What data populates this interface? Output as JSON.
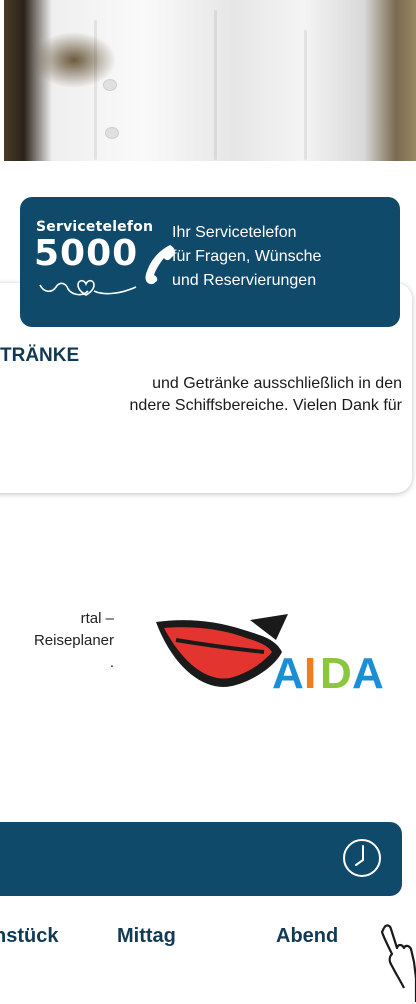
{
  "service": {
    "label": "Servicetelefon",
    "number": "5000",
    "text_line1": "Ihr Servicetelefon",
    "text_line2": "für Fragen, Wünsche",
    "text_line3": "und Reservierungen"
  },
  "notice": {
    "title": "TRÄNKE",
    "body_line1": "und Getränke ausschließlich in den",
    "body_line2": "ndere Schiffsbereiche. Vielen Dank für"
  },
  "portal": {
    "line1": "rtal –",
    "line2": "Reiseplaner",
    "line3": "."
  },
  "logo": {
    "text": "AIDA",
    "colors": [
      "#1a8fd6",
      "#f07c1a",
      "#8cc63f",
      "#1a8fd6"
    ]
  },
  "colors": {
    "brand_navy": "#0f4a6b",
    "lips_red": "#e3342f"
  },
  "meal_tabs": {
    "breakfast": "nstück",
    "lunch": "Mittag",
    "dinner": "Abend"
  },
  "icons": {
    "clock": "clock-icon",
    "phone": "phone-icon",
    "hand": "hand-pointer-icon"
  }
}
